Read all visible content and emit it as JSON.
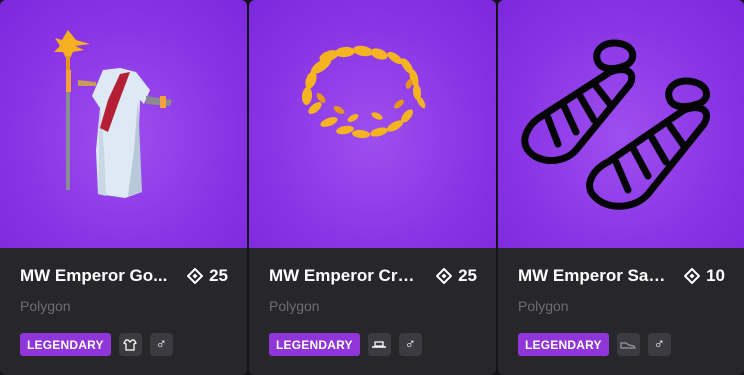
{
  "items": [
    {
      "name": "MW Emperor Gown",
      "name_display": "MW Emperor Go...",
      "price": "25",
      "creator": "Polygon",
      "rarity": "LEGENDARY",
      "category_icon": "shirt-icon",
      "gender": "♂"
    },
    {
      "name": "MW Emperor Crown",
      "name_display": "MW Emperor Cro...",
      "price": "25",
      "creator": "Polygon",
      "rarity": "LEGENDARY",
      "category_icon": "hat-icon",
      "gender": "♂"
    },
    {
      "name": "MW Emperor Sandals",
      "name_display": "MW Emperor San...",
      "price": "10",
      "creator": "Polygon",
      "rarity": "LEGENDARY",
      "category_icon": "shoe-icon",
      "gender": "♂"
    }
  ],
  "colors": {
    "card_bg": "#27262b",
    "thumb_purple": "#8a36e6",
    "rarity_legendary": "#8f35d9",
    "creator_text": "#6f6e74"
  }
}
